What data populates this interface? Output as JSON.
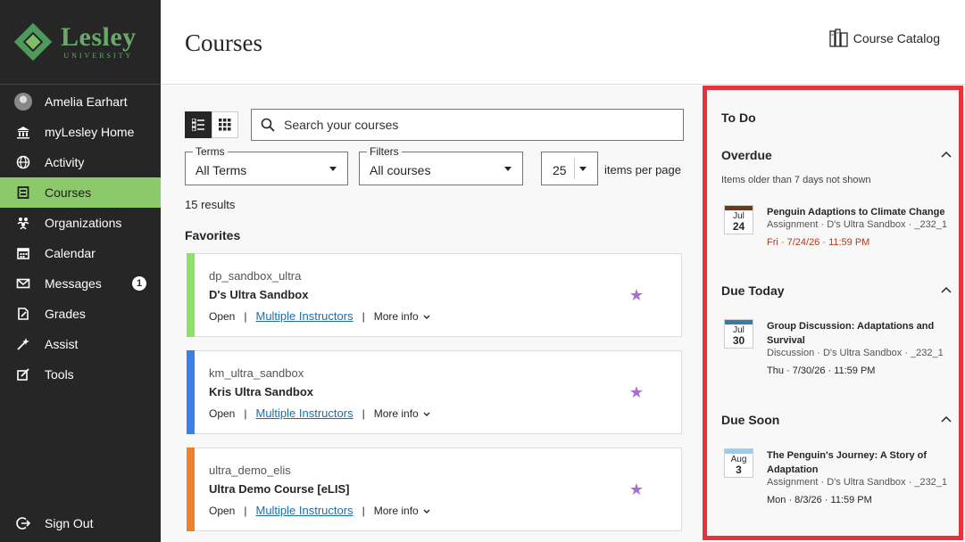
{
  "brand": {
    "name": "Lesley",
    "subtitle": "UNIVERSITY"
  },
  "sidebar": {
    "items": [
      {
        "label": "Amelia Earhart",
        "icon": "avatar"
      },
      {
        "label": "myLesley Home",
        "icon": "institution-icon"
      },
      {
        "label": "Activity",
        "icon": "globe-icon"
      },
      {
        "label": "Courses",
        "icon": "courses-icon",
        "active": true
      },
      {
        "label": "Organizations",
        "icon": "organizations-icon"
      },
      {
        "label": "Calendar",
        "icon": "calendar-icon"
      },
      {
        "label": "Messages",
        "icon": "envelope-icon",
        "badge": "1"
      },
      {
        "label": "Grades",
        "icon": "grades-icon"
      },
      {
        "label": "Assist",
        "icon": "assist-icon"
      },
      {
        "label": "Tools",
        "icon": "tools-icon"
      }
    ],
    "signout": "Sign Out"
  },
  "header": {
    "title": "Courses",
    "catalog": "Course Catalog"
  },
  "main": {
    "search_placeholder": "Search your courses",
    "terms": {
      "label": "Terms",
      "value": "All Terms"
    },
    "filters": {
      "label": "Filters",
      "value": "All courses"
    },
    "per_page": {
      "value": "25",
      "label": "items per page"
    },
    "results": "15 results",
    "favorites_title": "Favorites",
    "courses": [
      {
        "code": "dp_sandbox_ultra",
        "name": "D's Ultra Sandbox",
        "status": "Open",
        "instructors": "Multiple Instructors",
        "more": "More info",
        "color": "#8ee06a"
      },
      {
        "code": "km_ultra_sandbox",
        "name": "Kris Ultra Sandbox",
        "status": "Open",
        "instructors": "Multiple Instructors",
        "more": "More info",
        "color": "#3b7fe8"
      },
      {
        "code": "ultra_demo_elis",
        "name": "Ultra Demo Course [eLIS]",
        "status": "Open",
        "instructors": "Multiple Instructors",
        "more": "More info",
        "color": "#f07f2e"
      }
    ]
  },
  "todo": {
    "title": "To Do",
    "overdue": {
      "head": "Overdue",
      "note": "Items older than 7 days not shown",
      "item": {
        "mon": "Jul",
        "day": "24",
        "title": "Penguin Adaptions to Climate Change",
        "sub": "Assignment · D's Ultra Sandbox · _232_1",
        "due": "Fri · 7/24/26 · 11:59 PM",
        "color": "#6b3a1c"
      }
    },
    "today": {
      "head": "Due Today",
      "item": {
        "mon": "Jul",
        "day": "30",
        "title": "Group Discussion: Adaptations and Survival",
        "sub": "Discussion · D's Ultra Sandbox · _232_1",
        "due": "Thu · 7/30/26 · 11:59 PM",
        "color": "#3c7aa6"
      }
    },
    "soon": {
      "head": "Due Soon",
      "item": {
        "mon": "Aug",
        "day": "3",
        "title": "The Penguin's Journey: A Story of Adaptation",
        "sub": "Assignment · D's Ultra Sandbox · _232_1",
        "due": "Mon · 8/3/26 · 11:59 PM",
        "color": "#9fcbe8"
      }
    }
  }
}
